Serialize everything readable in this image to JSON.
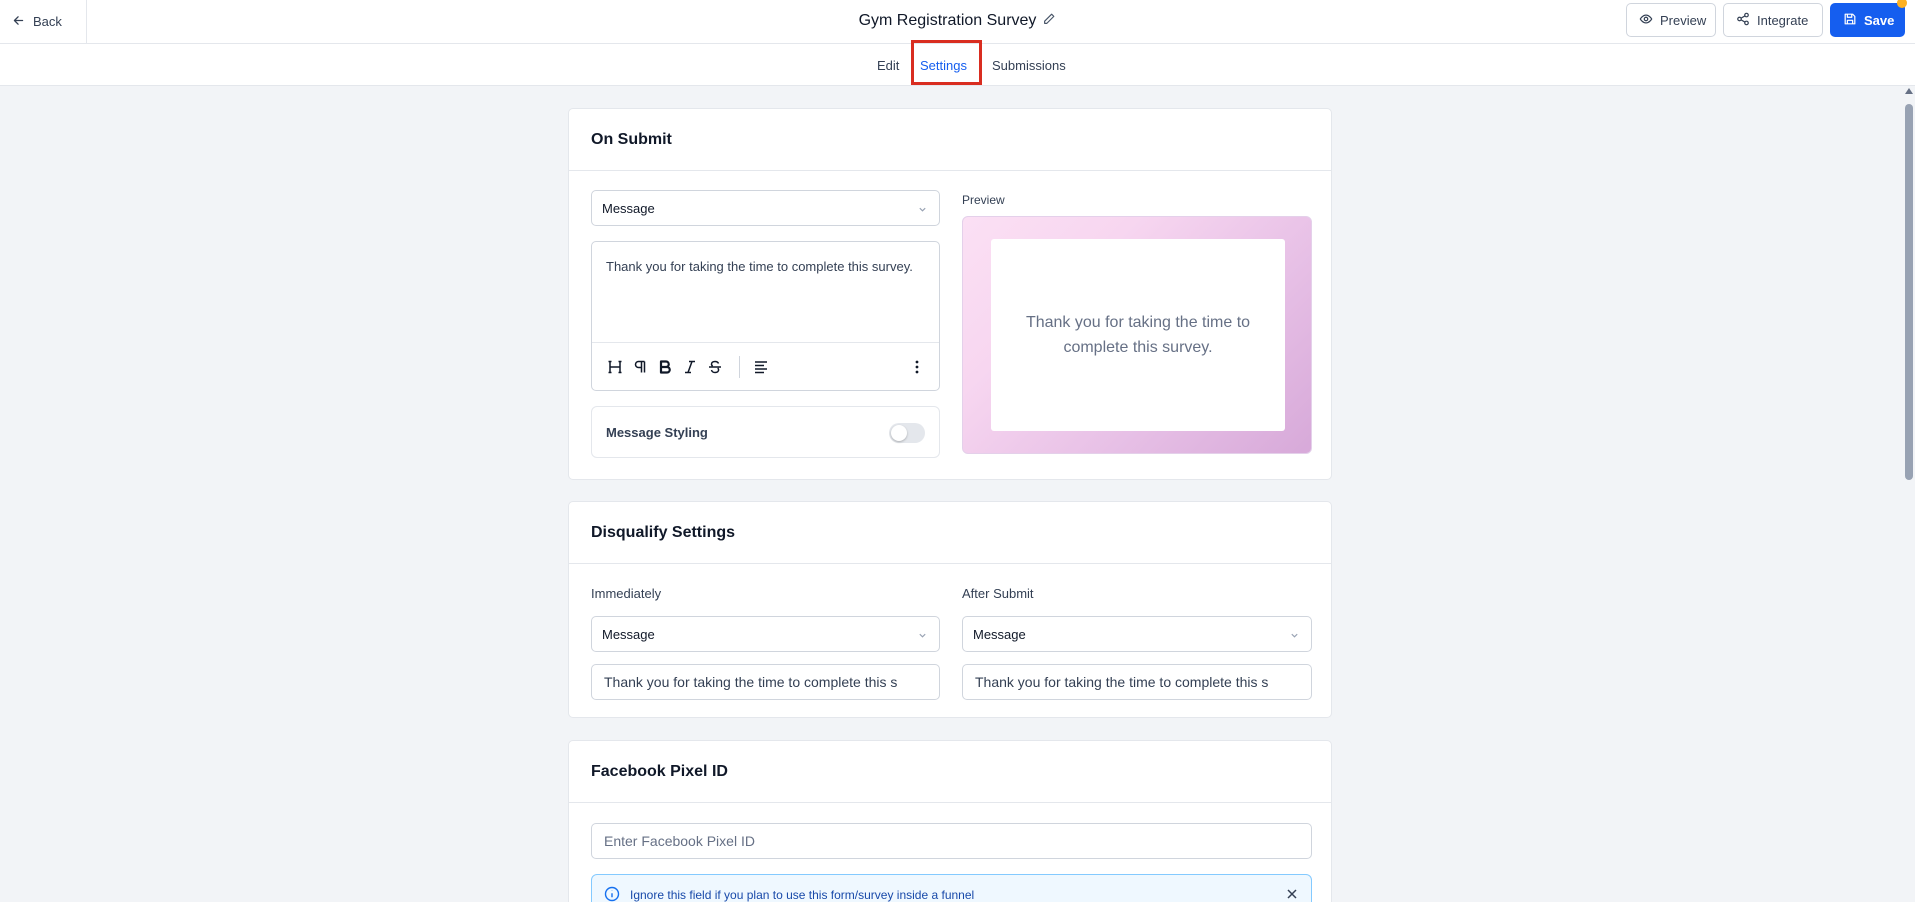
{
  "header": {
    "back_label": "Back",
    "title": "Gym Registration Survey",
    "preview_label": "Preview",
    "integrate_label": "Integrate",
    "save_label": "Save"
  },
  "tabs": [
    {
      "label": "Edit",
      "active": false
    },
    {
      "label": "Settings",
      "active": true
    },
    {
      "label": "Submissions",
      "active": false
    }
  ],
  "on_submit": {
    "heading": "On Submit",
    "action_select": "Message",
    "message_text": "Thank you for taking the time to complete this survey.",
    "toolbar_icons": [
      "heading-icon",
      "paragraph-icon",
      "bold-icon",
      "italic-icon",
      "strikethrough-icon",
      "align-left-icon",
      "more-vertical-icon"
    ],
    "message_styling_label": "Message Styling",
    "message_styling_enabled": false,
    "preview_label": "Preview",
    "preview_text": "Thank you for taking the time to complete this survey."
  },
  "disqualify": {
    "heading": "Disqualify Settings",
    "immediately_label": "Immediately",
    "immediately_select": "Message",
    "immediately_text": "Thank you for taking the time to complete this s",
    "after_submit_label": "After Submit",
    "after_submit_select": "Message",
    "after_submit_text": "Thank you for taking the time to complete this s"
  },
  "facebook": {
    "heading": "Facebook Pixel ID",
    "input_placeholder": "Enter Facebook Pixel ID",
    "info_text": "Ignore this field if you plan to use this form/survey inside a funnel"
  },
  "colors": {
    "accent": "#155eef",
    "highlight": "#d92d20",
    "notification_dot": "#fdb022"
  }
}
